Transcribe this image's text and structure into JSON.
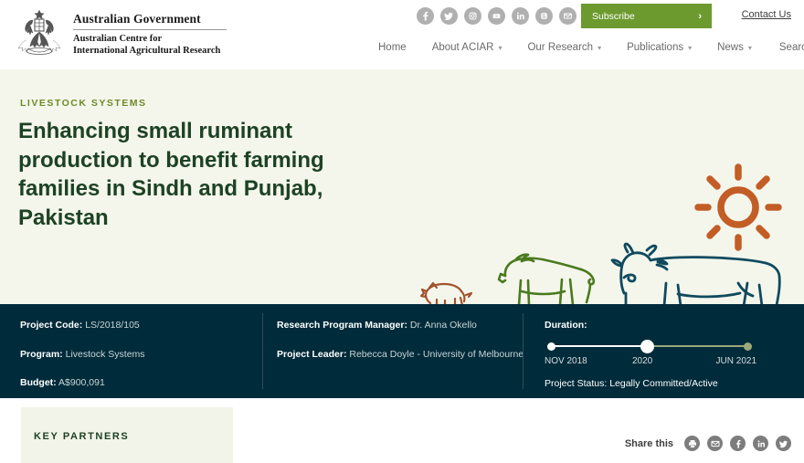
{
  "header": {
    "logo": {
      "crest_icon": "australian-coat-of-arms",
      "government_line": "Australian Government",
      "org_line_1": "Australian Centre for",
      "org_line_2": "International Agricultural Research"
    },
    "social_links": [
      {
        "name": "facebook-icon",
        "label": "Facebook"
      },
      {
        "name": "twitter-icon",
        "label": "Twitter"
      },
      {
        "name": "instagram-icon",
        "label": "Instagram"
      },
      {
        "name": "youtube-icon",
        "label": "YouTube"
      },
      {
        "name": "linkedin-icon",
        "label": "LinkedIn"
      },
      {
        "name": "blogger-icon",
        "label": "Blogger"
      },
      {
        "name": "email-icon",
        "label": "Email"
      }
    ],
    "subscribe_label": "Subscribe",
    "subscribe_chevron": "›",
    "contact_label": "Contact Us",
    "nav": [
      {
        "label": "Home",
        "has_caret": false
      },
      {
        "label": "About ACIAR",
        "has_caret": true
      },
      {
        "label": "Our Research",
        "has_caret": true
      },
      {
        "label": "Publications",
        "has_caret": true
      },
      {
        "label": "News",
        "has_caret": true
      }
    ],
    "search_label": "Search",
    "search_icon": "search-icon",
    "caret_glyph": "▾"
  },
  "hero": {
    "eyebrow": "LIVESTOCK SYSTEMS",
    "title": "Enhancing small ruminant production to benefit farming families in Sindh and Punjab, Pakistan",
    "illustration": {
      "sun_icon": "sun-icon",
      "animals": [
        "pig-illustration",
        "goat-illustration",
        "cow-illustration"
      ]
    }
  },
  "info": {
    "project_code_label": "Project Code:",
    "project_code_value": "LS/2018/105",
    "program_label": "Program:",
    "program_value": "Livestock Systems",
    "budget_label": "Budget:",
    "budget_value": "A$900,091",
    "rpm_label": "Research Program Manager:",
    "rpm_value": "Dr. Anna Okello",
    "leader_label": "Project Leader:",
    "leader_value": "Rebecca Doyle - University of Melbourne",
    "duration_label": "Duration:",
    "timeline": {
      "start": "NOV 2018",
      "current": "2020",
      "end": "JUN 2021"
    },
    "status_label": "Project Status:",
    "status_value": "Legally Committed/Active"
  },
  "bottom": {
    "key_partners_heading": "KEY PARTNERS",
    "share_label": "Share this",
    "share_icons": [
      {
        "name": "print-icon",
        "label": "Print"
      },
      {
        "name": "email-icon",
        "label": "Email"
      },
      {
        "name": "facebook-icon",
        "label": "Facebook"
      },
      {
        "name": "linkedin-icon",
        "label": "LinkedIn"
      },
      {
        "name": "twitter-icon",
        "label": "Twitter"
      }
    ]
  },
  "colors": {
    "hero_background": "#f4f6ec",
    "infobar_background": "#002b3a",
    "accent_green": "#6d9a2e",
    "title_green": "#1d4224",
    "eyebrow_green": "#6d8a25",
    "sun_orange": "#c35d26",
    "goat_green": "#4a7a1e",
    "cow_teal": "#0f4a5e",
    "pig_brown": "#a2522c",
    "timeline_sage": "#9aa87a"
  }
}
